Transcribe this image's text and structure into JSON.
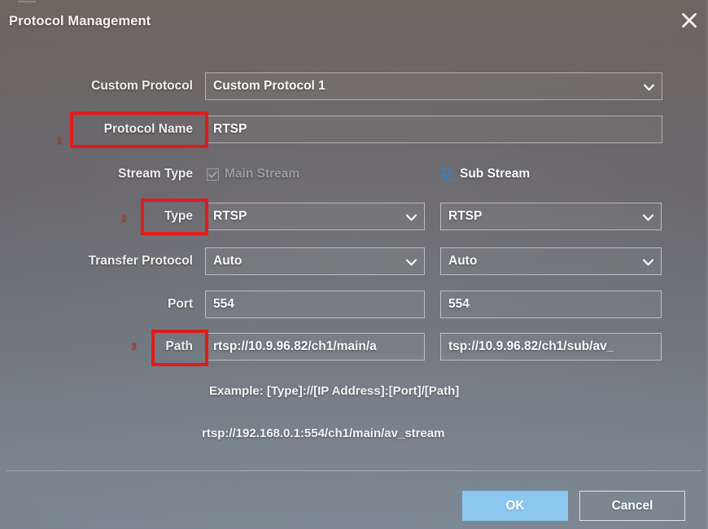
{
  "window": {
    "title": "Protocol Management",
    "close_icon": "close-icon"
  },
  "colors": {
    "accent_blue": "#8cc7f0",
    "checkbox_enabled": "#2f82d6",
    "annotation_red": "#e01b1b",
    "disabled_text": "#9b9ea1"
  },
  "form": {
    "custom_protocol": {
      "label": "Custom Protocol",
      "value": "Custom Protocol 1",
      "caret_icon": "chevron-down-icon"
    },
    "protocol_name": {
      "label": "Protocol Name",
      "value": "RTSP"
    },
    "stream_type": {
      "label": "Stream Type",
      "main": {
        "label": "Main Stream",
        "checked": true,
        "enabled": false
      },
      "sub": {
        "label": "Sub Stream",
        "checked": true,
        "enabled": true
      }
    },
    "type": {
      "label": "Type",
      "main_value": "RTSP",
      "sub_value": "RTSP",
      "caret_icon": "chevron-down-icon"
    },
    "transfer_protocol": {
      "label": "Transfer Protocol",
      "main_value": "Auto",
      "sub_value": "Auto",
      "caret_icon": "chevron-down-icon"
    },
    "port": {
      "label": "Port",
      "main_value": "554",
      "sub_value": "554"
    },
    "path": {
      "label": "Path",
      "main_value": "rtsp://10.9.96.82/ch1/main/a",
      "sub_value": "tsp://10.9.96.82/ch1/sub/av_"
    }
  },
  "hints": {
    "format": "Example: [Type]://[IP Address]:[Port]/[Path]",
    "sample": "rtsp://192.168.0.1:554/ch1/main/av_stream"
  },
  "footer": {
    "ok_label": "OK",
    "cancel_label": "Cancel"
  },
  "annotations": {
    "marker_1": "1",
    "marker_2": "2",
    "marker_3": "3"
  }
}
